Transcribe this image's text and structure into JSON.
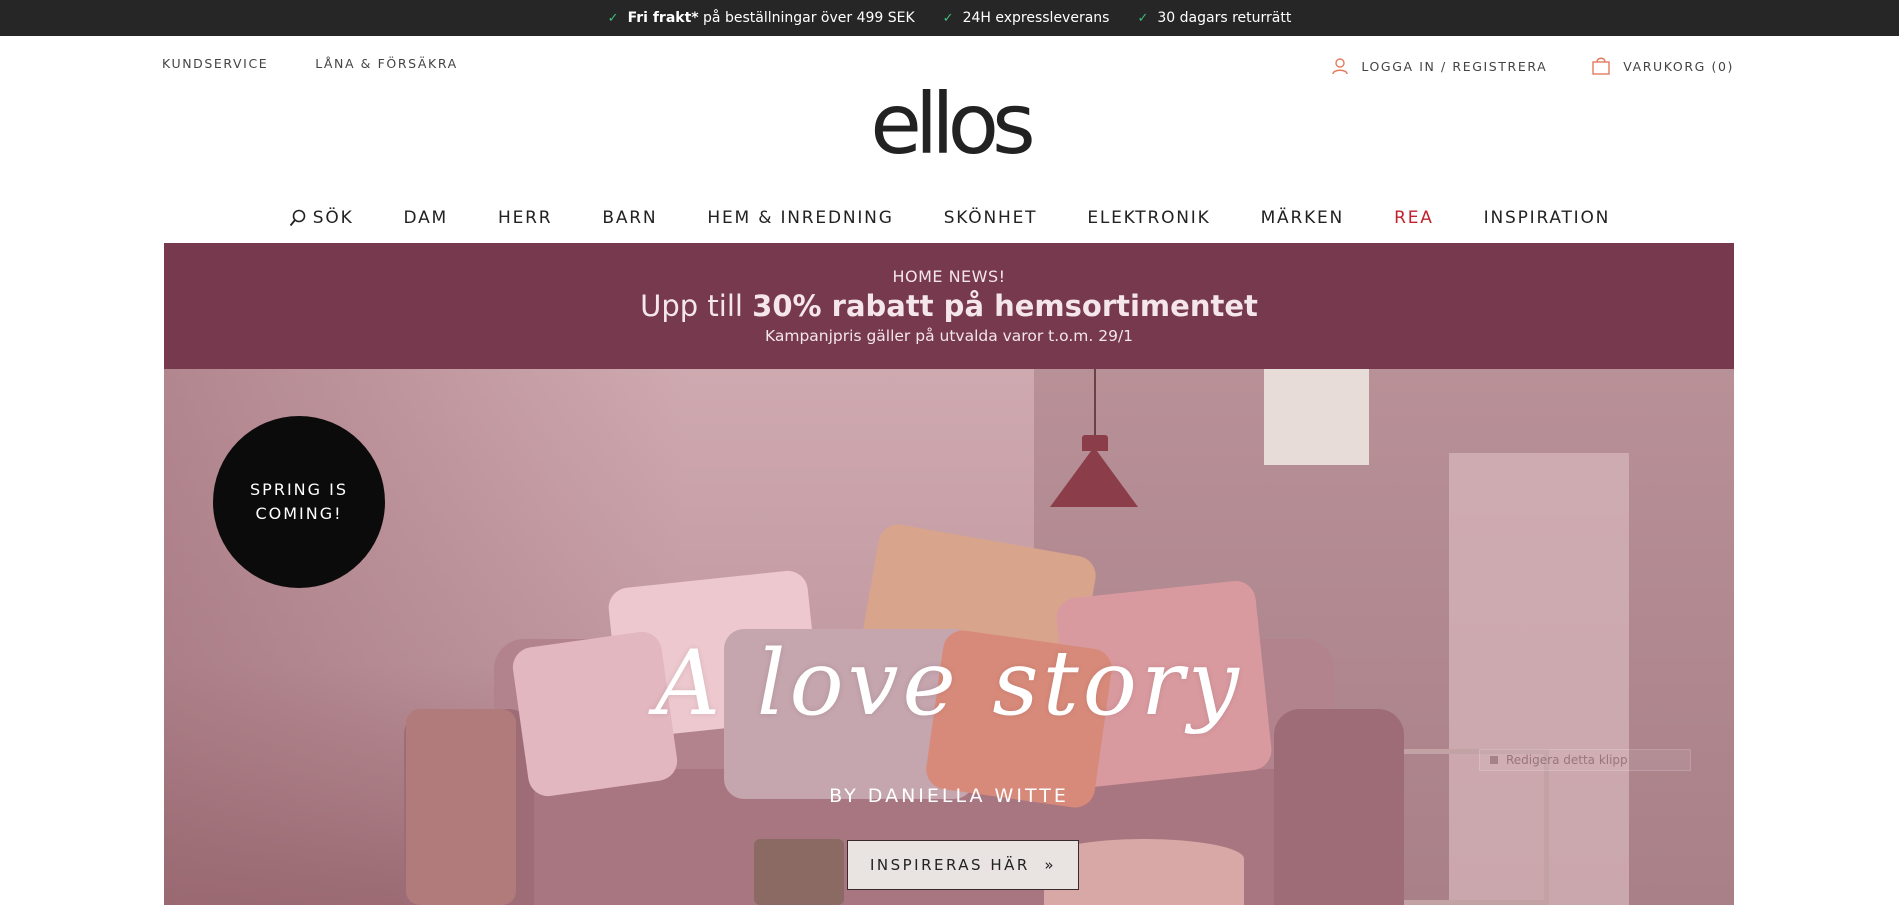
{
  "topbar": {
    "usp": [
      {
        "bold": "Fri frakt*",
        "text": " på beställningar över 499 SEK"
      },
      {
        "bold": "",
        "text": "24H expressleverans"
      },
      {
        "bold": "",
        "text": "30 dagars returrätt"
      }
    ],
    "check_icon": "check-icon",
    "check_color": "#3dbf7a"
  },
  "utility": {
    "left": [
      "KUNDSERVICE",
      "LÅNA & FÖRSÄKRA"
    ],
    "login": "LOGGA IN / REGISTRERA",
    "cart": "VARUKORG (0)",
    "accent_color": "#e47b5f"
  },
  "logo": {
    "text": "ellos"
  },
  "nav": {
    "search_label": "SÖK",
    "items": [
      "DAM",
      "HERR",
      "BARN",
      "HEM & INREDNING",
      "SKÖNHET",
      "ELEKTRONIK",
      "MÄRKEN",
      "REA",
      "INSPIRATION"
    ],
    "sale_color": "#c0232d"
  },
  "campaign": {
    "kicker": "HOME NEWS!",
    "headline_prefix": "Upp till ",
    "headline_bold": "30% rabatt på hemsortimentet",
    "sub": "Kampanjpris gäller på utvalda varor t.o.m. 29/1",
    "background": "#76394d"
  },
  "hero": {
    "badge": [
      "SPRING IS",
      "COMING!"
    ],
    "script_title": "A love story",
    "byline": "BY DANIELLA WITTE",
    "cta_label": "INSPIRERAS HÄR",
    "cta_arrow": "»",
    "overlay_text": "Redigera detta klipp"
  }
}
